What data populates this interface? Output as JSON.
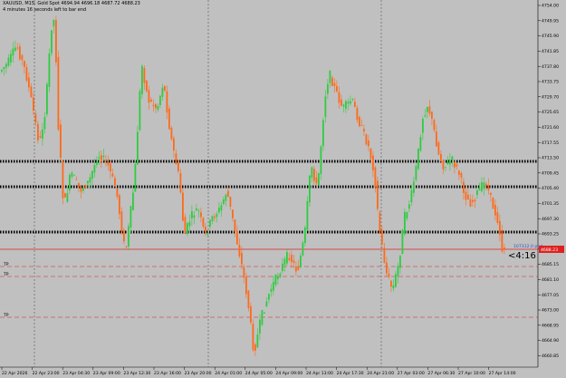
{
  "header": {
    "line1": "XAUUSD, M15: Gold Spot  4694.94 4696.18 4687.72 4688.23",
    "line2": "4 minutes 16 seconds left to bar end"
  },
  "timer": "<4:16",
  "price_axis": {
    "labels": [
      "4754.00",
      "4749.95",
      "4745.90",
      "4741.85",
      "4737.80",
      "4733.75",
      "4729.70",
      "4725.65",
      "4721.60",
      "4717.55",
      "4713.50",
      "4709.45",
      "4705.40",
      "4701.35",
      "4697.30",
      "4693.25",
      "4689.20",
      "4685.15",
      "4681.10",
      "4677.05",
      "4673.00",
      "4668.95",
      "4664.90",
      "4660.85"
    ],
    "current_price": "4688.23"
  },
  "time_axis": {
    "labels": [
      "22 Apr 2026",
      "22 Apr 23:00",
      "23 Apr 04:30",
      "23 Apr 09:00",
      "23 Apr 12:30",
      "23 Apr 16:00",
      "23 Apr 20:00",
      "24 Apr 01:00",
      "24 Apr 05:00",
      "24 Apr 09:00",
      "24 Apr 13:00",
      "24 Apr 17:30",
      "24 Apr 21:00",
      "27 Apr 03:00",
      "27 Apr 06:30",
      "27 Apr 10:00",
      "27 Apr 14:00"
    ]
  },
  "levels": {
    "tp_label": "TP",
    "current_label": "107312.0 ped"
  },
  "colors": {
    "background": "#c0c0c0",
    "bull": "#2ecc40",
    "bear": "#ff6a1a",
    "current_line": "#e02020",
    "tp_line": "#e02020"
  }
}
